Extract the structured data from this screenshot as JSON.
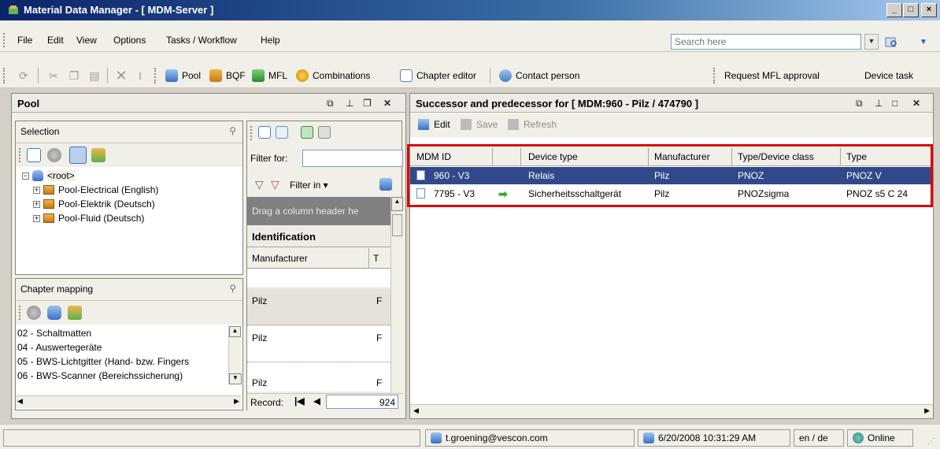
{
  "window": {
    "title": "Material Data Manager   -   [ MDM-Server ]"
  },
  "menu": [
    "File",
    "Edit",
    "View",
    "Options",
    "Tasks / Workflow",
    "Help"
  ],
  "search": {
    "placeholder": "Search here"
  },
  "toolbar": {
    "pool": "Pool",
    "bqf": "BQF",
    "mfl": "MFL",
    "combinations": "Combinations",
    "chapter_editor": "Chapter editor",
    "contact_person": "Contact person",
    "request_mfl": "Request MFL approval",
    "device_task": "Device task"
  },
  "pool_panel": {
    "title": "Pool",
    "selection": {
      "title": "Selection",
      "tree": {
        "root": "<root>",
        "children": [
          "Pool-Electrical (English)",
          "Pool-Elektrik (Deutsch)",
          "Pool-Fluid (Deutsch)"
        ]
      }
    },
    "chapter_mapping": {
      "title": "Chapter mapping",
      "items": [
        "02 - Schaltmatten",
        "04 - Auswertegeräte",
        "05 - BWS-Lichtgitter (Hand- bzw. Fingers",
        "06 - BWS-Scanner (Bereichssicherung)"
      ]
    },
    "grid": {
      "filter_for": "Filter for:",
      "filter_in": "Filter in",
      "drag_hint": "Drag a column header he",
      "group": "Identification",
      "col_manufacturer": "Manufacturer",
      "col_t": "T",
      "rows": [
        {
          "manufacturer": "Pilz",
          "t": "F"
        },
        {
          "manufacturer": "Pilz",
          "t": "F"
        },
        {
          "manufacturer": "Pilz",
          "t": "F"
        }
      ],
      "record_label": "Record:",
      "record_value": "924"
    }
  },
  "successor_panel": {
    "title": "Successor and predecessor for [ MDM:960 - Pilz / 474790 ]",
    "actions": {
      "edit": "Edit",
      "save": "Save",
      "refresh": "Refresh"
    },
    "columns": [
      "MDM ID",
      "",
      "Device type",
      "Manufacturer",
      "Type/Device class",
      "Type"
    ],
    "rows": [
      {
        "mdm_id": "960 - V3",
        "device_type": "Relais",
        "manufacturer": "Pilz",
        "class": "PNOZ",
        "type": "PNOZ V"
      },
      {
        "mdm_id": "7795 - V3",
        "device_type": "Sicherheitsschaltgerät",
        "manufacturer": "Pilz",
        "class": "PNOZsigma",
        "type": "PNOZ s5 C 24"
      }
    ]
  },
  "status": {
    "user": "t.groening@vescon.com",
    "timestamp": "6/20/2008 10:31:29 AM",
    "lang": "en / de",
    "online": "Online"
  },
  "colors": {
    "highlight_border": "#e00000",
    "selected_row": "#31498a",
    "title_bar": "#0a246a"
  }
}
